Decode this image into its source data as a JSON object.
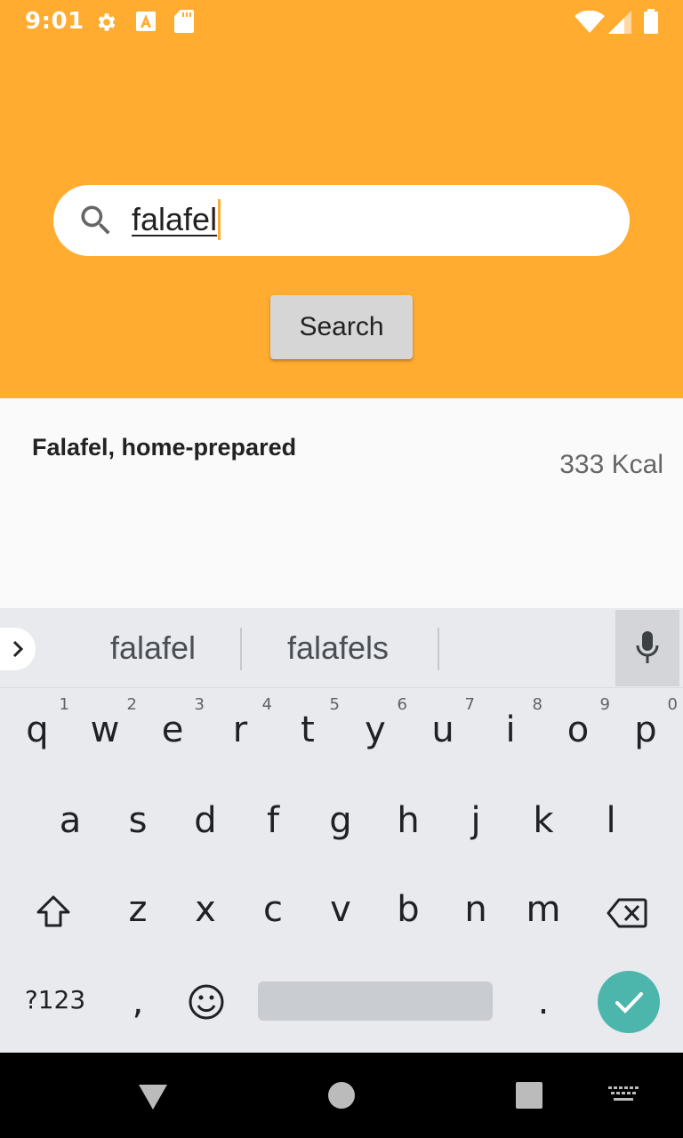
{
  "status_bar": {
    "time": "9:01",
    "icons": [
      "gear-icon",
      "font-a-icon",
      "sd-card-icon",
      "wifi-icon",
      "signal-icon",
      "battery-icon"
    ]
  },
  "search": {
    "query": "falafel",
    "button_label": "Search",
    "accent_color": "#ffac30"
  },
  "results": [
    {
      "name": "Falafel, home-prepared",
      "calories": "333 Kcal"
    }
  ],
  "keyboard": {
    "suggestions": [
      "falafel",
      "falafels"
    ],
    "row1": [
      {
        "key": "q",
        "hint": "1"
      },
      {
        "key": "w",
        "hint": "2"
      },
      {
        "key": "e",
        "hint": "3"
      },
      {
        "key": "r",
        "hint": "4"
      },
      {
        "key": "t",
        "hint": "5"
      },
      {
        "key": "y",
        "hint": "6"
      },
      {
        "key": "u",
        "hint": "7"
      },
      {
        "key": "i",
        "hint": "8"
      },
      {
        "key": "o",
        "hint": "9"
      },
      {
        "key": "p",
        "hint": "0"
      }
    ],
    "row2": [
      "a",
      "s",
      "d",
      "f",
      "g",
      "h",
      "j",
      "k",
      "l"
    ],
    "row3": [
      "z",
      "x",
      "c",
      "v",
      "b",
      "n",
      "m"
    ],
    "symbols_label": "?123",
    "comma": ",",
    "period": ".",
    "enter_color": "#4db6ac"
  },
  "nav_bar": {
    "icons": [
      "back-icon",
      "home-icon",
      "recents-icon",
      "keyboard-switch-icon"
    ]
  }
}
